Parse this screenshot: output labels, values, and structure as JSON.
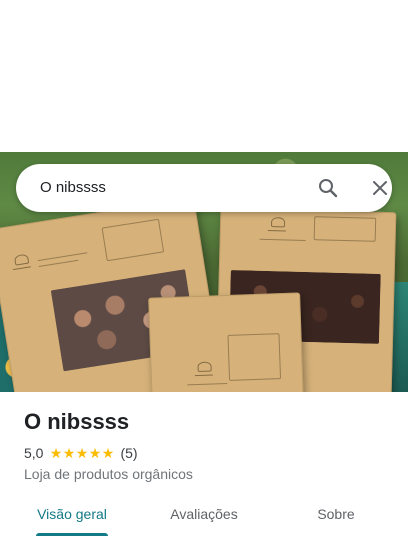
{
  "search": {
    "query": "O nibssss",
    "search_icon": "search-icon",
    "close_icon": "close-icon"
  },
  "place": {
    "name": "O nibssss",
    "rating": "5,0",
    "stars": 5,
    "review_count": "(5)",
    "category": "Loja de produtos orgânicos"
  },
  "tabs": [
    {
      "label": "Visão geral",
      "active": true
    },
    {
      "label": "Avaliações",
      "active": false
    },
    {
      "label": "Sobre",
      "active": false
    }
  ],
  "colors": {
    "accent": "#137a86",
    "star": "#fbbc04"
  }
}
